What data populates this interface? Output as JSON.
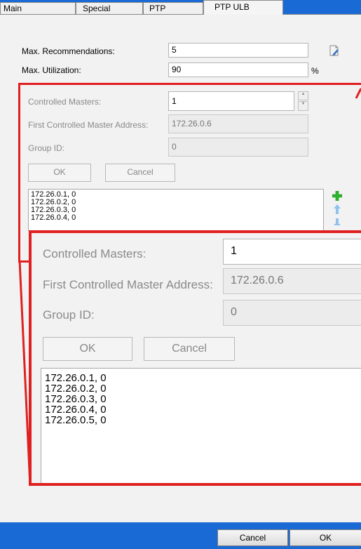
{
  "tabs": [
    {
      "label": "Main"
    },
    {
      "label": "Special"
    },
    {
      "label": "PTP"
    },
    {
      "label": "PTP ULB"
    }
  ],
  "form": {
    "max_recommendations_label": "Max. Recommendations:",
    "max_recommendations_value": "5",
    "max_utilization_label": "Max. Utilization:",
    "max_utilization_value": "90",
    "percent_unit": "%"
  },
  "ulb": {
    "controlled_masters_label": "Controlled Masters:",
    "controlled_masters_value": "1",
    "first_address_label": "First Controlled Master Address:",
    "first_address_value": "172.26.0.6",
    "group_id_label": "Group ID:",
    "group_id_value": "0",
    "ok_label": "OK",
    "cancel_label": "Cancel",
    "entries_small": [
      "172.26.0.1, 0",
      "172.26.0.2, 0",
      "172.26.0.3, 0",
      "172.26.0.4, 0"
    ],
    "entries": [
      "172.26.0.1, 0",
      "172.26.0.2, 0",
      "172.26.0.3, 0",
      "172.26.0.4, 0",
      "172.26.0.5, 0"
    ]
  },
  "footer": {
    "cancel_label": "Cancel",
    "ok_label": "OK"
  },
  "icons": {
    "edit": "edit-document-icon",
    "add": "add-icon",
    "up": "arrow-up-icon",
    "down": "arrow-down-icon"
  },
  "colors": {
    "highlight": "#e02020",
    "frame": "#1a6ad6",
    "add": "#2db52d",
    "arrows": "#8fc2ee"
  }
}
